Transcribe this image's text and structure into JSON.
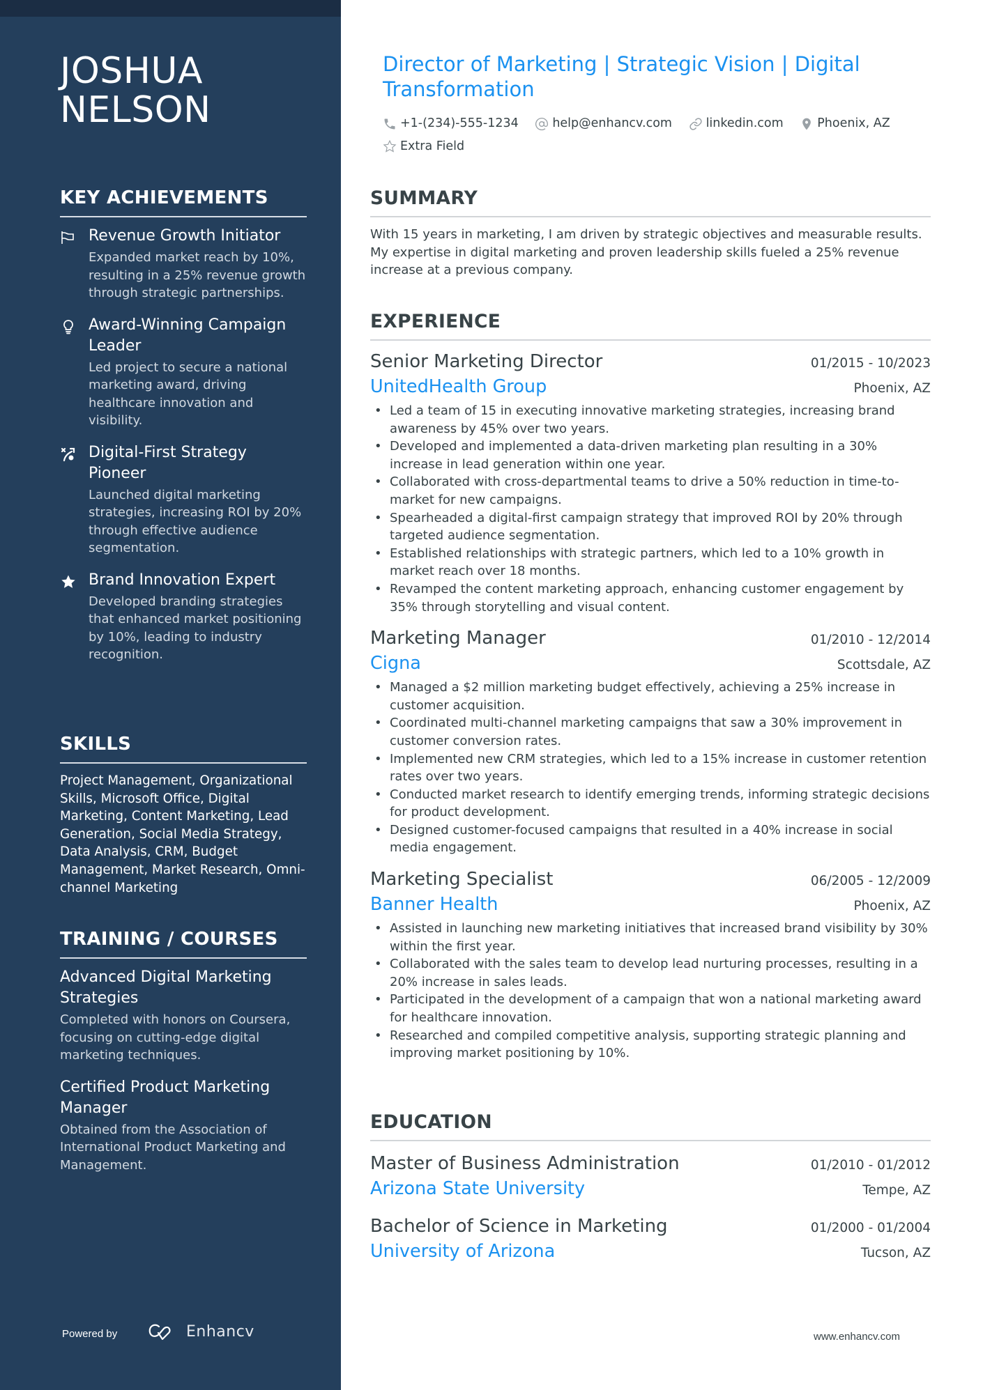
{
  "profile": {
    "name": "JOSHUA NELSON",
    "headline": "Director of Marketing | Strategic Vision | Digital Transformation",
    "contacts": [
      {
        "icon": "phone-icon",
        "text": "+1-(234)-555-1234"
      },
      {
        "icon": "at-icon",
        "text": "help@enhancv.com"
      },
      {
        "icon": "link-icon",
        "text": "linkedin.com"
      },
      {
        "icon": "location-pin-icon",
        "text": "Phoenix, AZ"
      },
      {
        "icon": "star-outline-icon",
        "text": "Extra Field"
      }
    ]
  },
  "sidebar": {
    "achievements": {
      "heading": "KEY ACHIEVEMENTS",
      "items": [
        {
          "icon": "flag-icon",
          "title": "Revenue Growth Initiator",
          "description": "Expanded market reach by 10%, resulting in a 25% revenue growth through strategic partnerships."
        },
        {
          "icon": "lightbulb-icon",
          "title": "Award-Winning Campaign Leader",
          "description": "Led project to secure a national marketing award, driving healthcare innovation and visibility."
        },
        {
          "icon": "strategy-icon",
          "title": "Digital-First Strategy Pioneer",
          "description": "Launched digital marketing strategies, increasing ROI by 20% through effective audience segmentation."
        },
        {
          "icon": "star-icon",
          "title": "Brand Innovation Expert",
          "description": "Developed branding strategies that enhanced market positioning by 10%, leading to industry recognition."
        }
      ]
    },
    "skills": {
      "heading": "SKILLS",
      "text": "Project Management, Organizational Skills, Microsoft Office, Digital Marketing, Content Marketing, Lead Generation, Social Media Strategy, Data Analysis, CRM, Budget Management, Market Research, Omni-channel Marketing"
    },
    "training": {
      "heading": "TRAINING / COURSES",
      "items": [
        {
          "title": "Advanced Digital Marketing Strategies",
          "description": "Completed with honors on Coursera, focusing on cutting-edge digital marketing techniques."
        },
        {
          "title": "Certified Product Marketing Manager",
          "description": "Obtained from the Association of International Product Marketing and Management."
        }
      ]
    },
    "footer": {
      "powered_by": "Powered by",
      "brand": "Enhancv"
    }
  },
  "summary": {
    "heading": "SUMMARY",
    "text": "With 15 years in marketing, I am driven by strategic objectives and measurable results. My expertise in digital marketing and proven leadership skills fueled a 25% revenue increase at a previous company."
  },
  "experience": {
    "heading": "EXPERIENCE",
    "jobs": [
      {
        "title": "Senior Marketing Director",
        "dates": "01/2015 - 10/2023",
        "company": "UnitedHealth Group",
        "location": "Phoenix, AZ",
        "bullets": [
          "Led a team of 15 in executing innovative marketing strategies, increasing brand awareness by 45% over two years.",
          "Developed and implemented a data-driven marketing plan resulting in a 30% increase in lead generation within one year.",
          "Collaborated with cross-departmental teams to drive a 50% reduction in time-to-market for new campaigns.",
          "Spearheaded a digital-first campaign strategy that improved ROI by 20% through targeted audience segmentation.",
          "Established relationships with strategic partners, which led to a 10% growth in market reach over 18 months.",
          "Revamped the content marketing approach, enhancing customer engagement by 35% through storytelling and visual content."
        ]
      },
      {
        "title": "Marketing Manager",
        "dates": "01/2010 - 12/2014",
        "company": "Cigna",
        "location": "Scottsdale, AZ",
        "bullets": [
          "Managed a $2 million marketing budget effectively, achieving a 25% increase in customer acquisition.",
          "Coordinated multi-channel marketing campaigns that saw a 30% improvement in customer conversion rates.",
          "Implemented new CRM strategies, which led to a 15% increase in customer retention rates over two years.",
          "Conducted market research to identify emerging trends, informing strategic decisions for product development.",
          "Designed customer-focused campaigns that resulted in a 40% increase in social media engagement."
        ]
      },
      {
        "title": "Marketing Specialist",
        "dates": "06/2005 - 12/2009",
        "company": "Banner Health",
        "location": "Phoenix, AZ",
        "bullets": [
          "Assisted in launching new marketing initiatives that increased brand visibility by 30% within the first year.",
          "Collaborated with the sales team to develop lead nurturing processes, resulting in a 20% increase in sales leads.",
          "Participated in the development of a campaign that won a national marketing award for healthcare innovation.",
          "Researched and compiled competitive analysis, supporting strategic planning and improving market positioning by 10%."
        ]
      }
    ]
  },
  "education": {
    "heading": "EDUCATION",
    "items": [
      {
        "degree": "Master of Business Administration",
        "dates": "01/2010 - 01/2012",
        "school": "Arizona State University",
        "location": "Tempe, AZ"
      },
      {
        "degree": "Bachelor of Science in Marketing",
        "dates": "01/2000 - 01/2004",
        "school": "University of Arizona",
        "location": "Tucson, AZ"
      }
    ]
  },
  "footer": {
    "website": "www.enhancv.com"
  },
  "colors": {
    "sidebar": "#243f5c",
    "sidebar_top_band": "#1b2d44",
    "accent": "#1a91f0",
    "text": "#384347"
  }
}
